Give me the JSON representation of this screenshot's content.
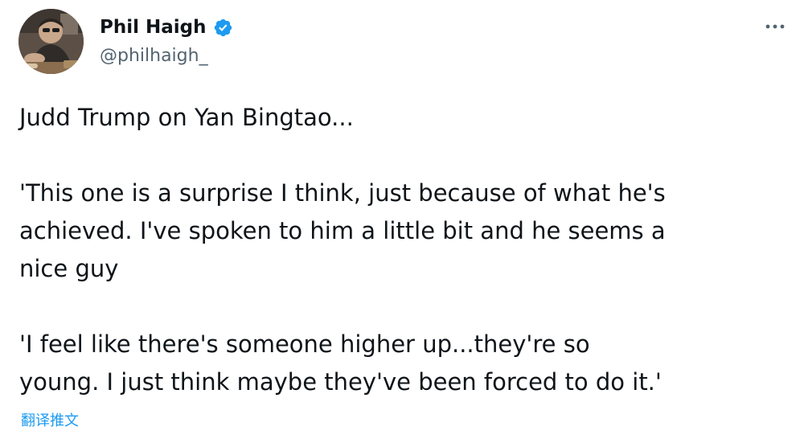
{
  "author": {
    "display_name": "Phil Haigh",
    "handle": "@philhaigh_",
    "verified": true,
    "avatar_icon": "user-avatar-photo"
  },
  "tweet": {
    "paragraphs": [
      "Judd Trump on Yan Bingtao...",
      "'This one is a surprise I think, just because of what he's\nachieved. I've spoken to him a little bit and he seems a\nnice guy",
      "'I feel like there's someone higher up...they're so\nyoung. I just think maybe they've been forced to do it.'"
    ]
  },
  "actions": {
    "more_icon": "more-horizontal-icon",
    "translate_label": "翻译推文"
  },
  "colors": {
    "text_primary": "#0f1419",
    "text_secondary": "#536471",
    "accent": "#1d9bf0"
  }
}
